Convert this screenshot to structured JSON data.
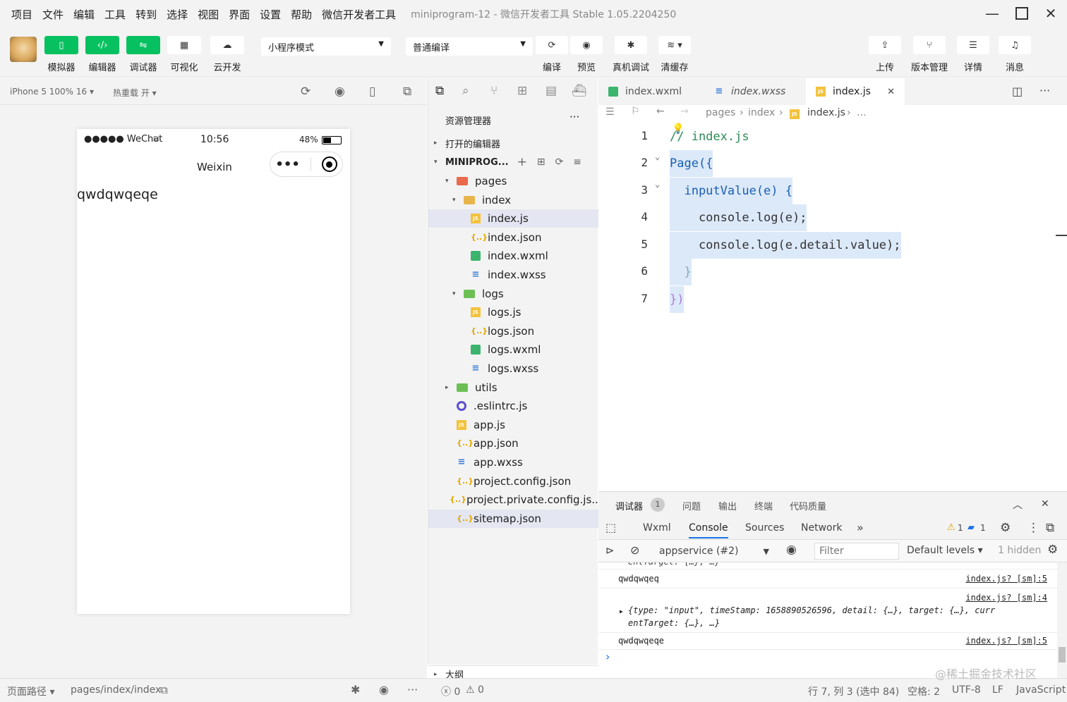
{
  "menu": [
    "项目",
    "文件",
    "编辑",
    "工具",
    "转到",
    "选择",
    "视图",
    "界面",
    "设置",
    "帮助",
    "微信开发者工具"
  ],
  "window_title": "miniprogram-12 - 微信开发者工具 Stable 1.05.2204250",
  "toolbar": {
    "simulator": "模拟器",
    "editor": "编辑器",
    "debugger": "调试器",
    "visual": "可视化",
    "cloud": "云开发",
    "mode_select": "小程序模式",
    "compile_select": "普通编译",
    "compile": "编译",
    "preview": "预览",
    "remote_debug": "真机调试",
    "clear_cache": "清缓存",
    "upload": "上传",
    "version": "版本管理",
    "details": "详情",
    "messages": "消息"
  },
  "simbar": {
    "device": "iPhone 5 100% 16 ▾",
    "hot_reload": "热重载 开 ▾"
  },
  "phone": {
    "signal": "●●●●● WeChat",
    "time": "10:56",
    "battery": "48%",
    "title": "Weixin",
    "content": "qwdqwqeqe"
  },
  "explorer": {
    "title": "资源管理器",
    "more": "···",
    "open_editors": "打开的编辑器",
    "project": "MINIPROG...",
    "outline": "大纲",
    "tree": [
      {
        "label": "pages",
        "icon": "folder-red",
        "indent": 0,
        "arrow": "▾"
      },
      {
        "label": "index",
        "icon": "folder",
        "indent": 1,
        "arrow": "▾"
      },
      {
        "label": "index.js",
        "icon": "js",
        "indent": 2,
        "arrow": "",
        "selected": true
      },
      {
        "label": "index.json",
        "icon": "json",
        "indent": 2,
        "arrow": ""
      },
      {
        "label": "index.wxml",
        "icon": "wxml",
        "indent": 2,
        "arrow": ""
      },
      {
        "label": "index.wxss",
        "icon": "wxss",
        "indent": 2,
        "arrow": ""
      },
      {
        "label": "logs",
        "icon": "folder-green",
        "indent": 1,
        "arrow": "▾"
      },
      {
        "label": "logs.js",
        "icon": "js",
        "indent": 2,
        "arrow": ""
      },
      {
        "label": "logs.json",
        "icon": "json",
        "indent": 2,
        "arrow": ""
      },
      {
        "label": "logs.wxml",
        "icon": "wxml",
        "indent": 2,
        "arrow": ""
      },
      {
        "label": "logs.wxss",
        "icon": "wxss",
        "indent": 2,
        "arrow": ""
      },
      {
        "label": "utils",
        "icon": "folder-green",
        "indent": 0,
        "arrow": "▸"
      },
      {
        "label": ".eslintrc.js",
        "icon": "eslint",
        "indent": 0,
        "arrow": ""
      },
      {
        "label": "app.js",
        "icon": "js",
        "indent": 0,
        "arrow": ""
      },
      {
        "label": "app.json",
        "icon": "json",
        "indent": 0,
        "arrow": ""
      },
      {
        "label": "app.wxss",
        "icon": "wxss",
        "indent": 0,
        "arrow": ""
      },
      {
        "label": "project.config.json",
        "icon": "json",
        "indent": 0,
        "arrow": ""
      },
      {
        "label": "project.private.config.js...",
        "icon": "json",
        "indent": 0,
        "arrow": ""
      },
      {
        "label": "sitemap.json",
        "icon": "json",
        "indent": 0,
        "arrow": "",
        "selected": true
      }
    ]
  },
  "tabs": {
    "tab1": "index.wxml",
    "tab2": "index.wxss",
    "tab3": "index.js",
    "close": "✕"
  },
  "breadcrumb": {
    "p1": "pages",
    "p2": "index",
    "p3": "index.js",
    "p4": "..."
  },
  "code": {
    "lines": [
      "1",
      "2",
      "3",
      "4",
      "5",
      "6",
      "7"
    ],
    "l1": "// index.js",
    "l2": "Page({",
    "l3": "  inputValue(e) {",
    "l4": "    console.log(e);",
    "l5": "    console.log(e.detail.value);",
    "l6": "  }",
    "l7": "})"
  },
  "panel": {
    "debugger": "调试器",
    "debugger_count": "1",
    "issues": "问题",
    "output": "输出",
    "terminal": "终端",
    "quality": "代码质量",
    "dev_tabs": [
      "Wxml",
      "Console",
      "Sources",
      "Network"
    ],
    "more": "»",
    "warn_count": "1",
    "msg_count": "1",
    "context": "appservice (#2)",
    "filter_placeholder": "Filter",
    "levels": "Default levels ▾",
    "hidden": "1 hidden"
  },
  "console": {
    "partial": "entTarget: {…}, …}",
    "log1": "qwdqwqeq",
    "src1": "index.js? [sm]:5",
    "src2": "index.js? [sm]:4",
    "obj_a": "{type: \"input\", timeStamp: 1658890526596, detail: {…}, target: {…}, curr",
    "obj_b": "entTarget: {…}, …}",
    "log3": "qwdqwqeqe",
    "src3": "index.js? [sm]:5",
    "prompt": "›"
  },
  "status": {
    "page_path_label": "页面路径 ▾",
    "page_path": "pages/index/index",
    "errors": "ⓧ 0",
    "warnings": "⚠ 0",
    "cursor": "行 7, 列 3 (选中 84)",
    "indent": "空格: 2",
    "encoding": "UTF-8",
    "eol": "LF",
    "language": "JavaScript",
    "watermark": "@稀土掘金技术社区"
  }
}
